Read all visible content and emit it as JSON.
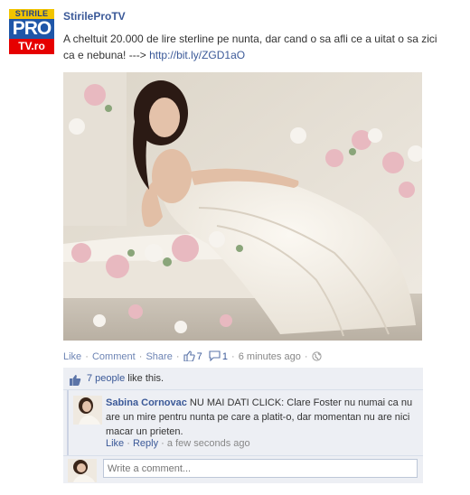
{
  "page": {
    "name": "StirileProTV",
    "avatar": {
      "top": "STIRILE",
      "big": "PRO",
      "small": "TV.ro"
    }
  },
  "post": {
    "text": "A cheltuit 20.000 de lire sterline pe nunta, dar cand o sa afli ce a uitat o sa zici ca e nebuna! --->",
    "link": "http://bit.ly/ZGD1aO"
  },
  "actions": {
    "like": "Like",
    "comment": "Comment",
    "share": "Share",
    "likes_count": "7",
    "comments_count": "1",
    "time": "6 minutes ago"
  },
  "ufi": {
    "likes_link": "7 people",
    "likes_suffix": "like this.",
    "comments": [
      {
        "author": "Sabina Cornovac",
        "text": "NU MAI DATI CLICK: Clare Foster nu numai ca nu are un mire pentru nunta pe care a platit-o, dar momentan nu are nici macar un prieten.",
        "like": "Like",
        "reply": "Reply",
        "time": "a few seconds ago"
      }
    ],
    "write_placeholder": "Write a comment..."
  },
  "colors": {
    "link": "#3b5998",
    "ufi_bg": "#edeff4"
  },
  "icons": [
    "thumbs-up-icon",
    "comment-bubble-icon",
    "globe-icon"
  ]
}
